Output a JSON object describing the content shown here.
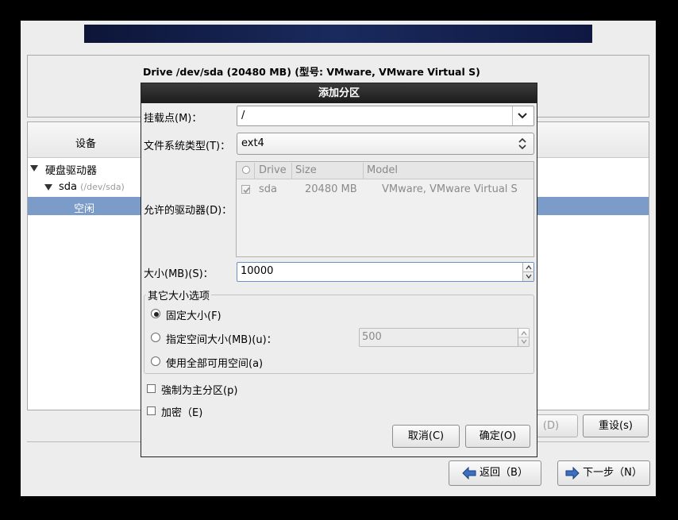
{
  "installer": {
    "drive_title": "Drive /dev/sda (20480 MB) (型号: VMware, VMware Virtual S)",
    "tree_header": "设备",
    "tree": {
      "root": "硬盘驱动器",
      "disk": "sda",
      "disk_path": "(/dev/sda)",
      "free": "空闲"
    },
    "buttons": {
      "delete": "(D)",
      "reset": "重设(s)",
      "back": "返回（B）",
      "next": "下一步（N）"
    }
  },
  "dialog": {
    "title": "添加分区",
    "mount_label": "挂载点(M)：",
    "mount_value": "/",
    "fstype_label": "文件系统类型(T)：",
    "fstype_value": "ext4",
    "drives_label": "允许的驱动器(D)：",
    "drives_columns": [
      "Drive",
      "Size",
      "Model"
    ],
    "drives_rows": [
      {
        "checked": true,
        "drive": "sda",
        "size": "20480 MB",
        "model": "VMware, VMware Virtual S"
      }
    ],
    "size_label": "大小(MB)(S)：",
    "size_value": "10000",
    "other_size_group": "其它大小选项",
    "opt_fixed": "固定大小(F)",
    "opt_upto": "指定空间大小(MB)(u)：",
    "opt_upto_value": "500",
    "opt_fill": "使用全部可用空间(a)",
    "selected_option": "fixed",
    "force_primary": "強制为主分区(p)",
    "encrypt": "加密（E)",
    "cancel": "取消(C)",
    "ok": "确定(O)"
  },
  "colors": {
    "selection": "#7b9bc9",
    "dialog_title_bg": "#2a2a2a",
    "banner": "#1a2a5e"
  }
}
